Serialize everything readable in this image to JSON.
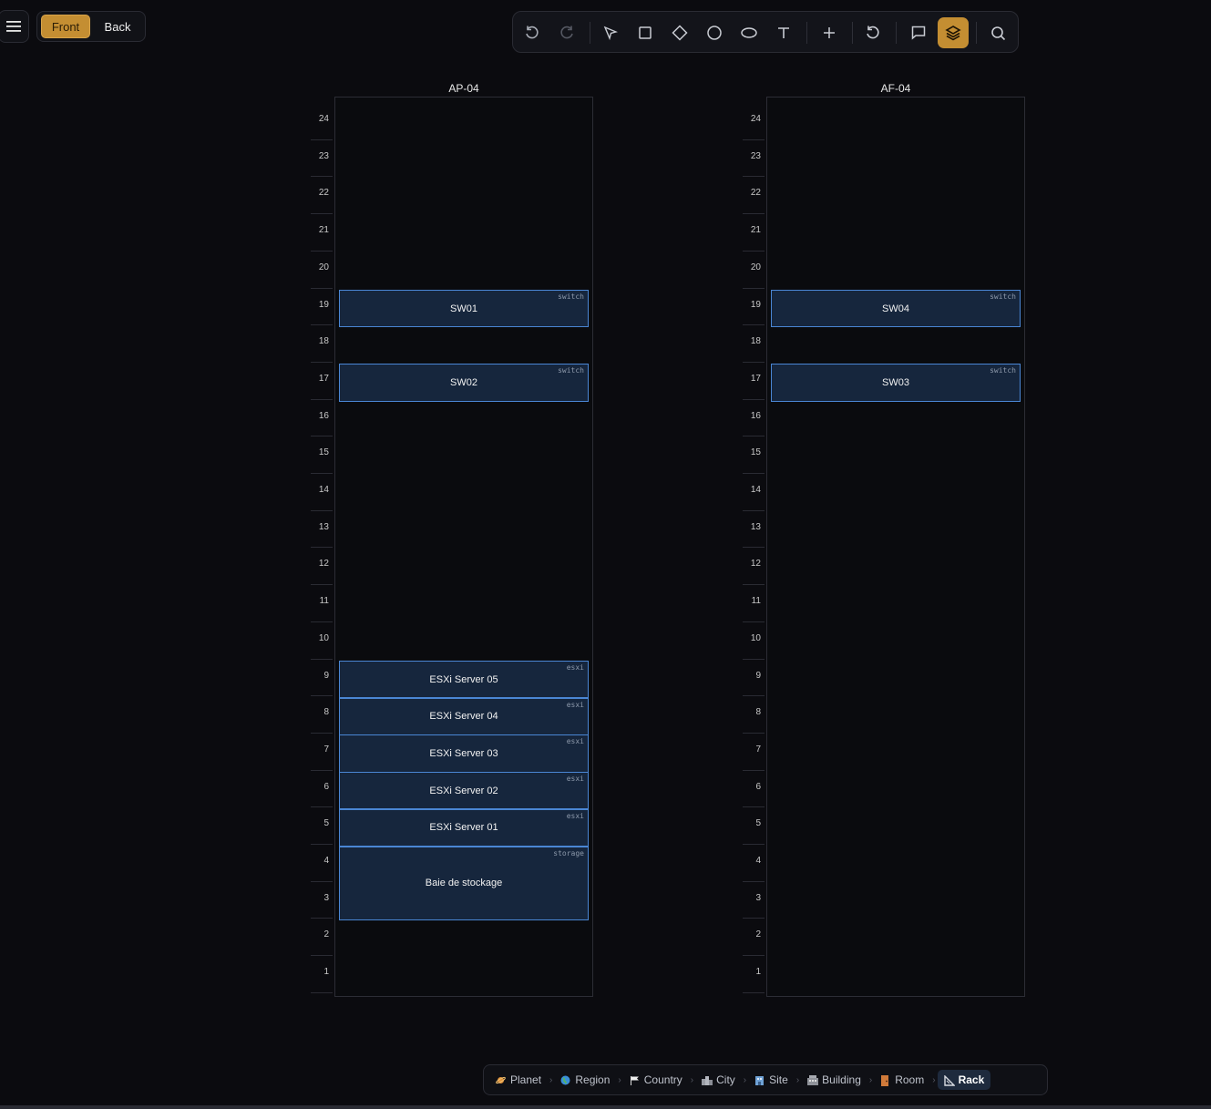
{
  "face_toggle": {
    "front_label": "Front",
    "back_label": "Back",
    "selected": "Front"
  },
  "toolbar": {
    "tools": [
      "undo-icon",
      "redo-icon",
      "select-icon",
      "rectangle-icon",
      "diamond-icon",
      "circle-icon",
      "ellipse-icon",
      "text-icon",
      "add-icon",
      "reset-icon",
      "comment-icon",
      "layers-icon",
      "search-icon"
    ],
    "active_tool": "layers-icon"
  },
  "racks": [
    {
      "name": "AP-04",
      "units": [
        "24",
        "23",
        "22",
        "21",
        "20",
        "19",
        "18",
        "17",
        "16",
        "15",
        "14",
        "13",
        "12",
        "11",
        "10",
        "9",
        "8",
        "7",
        "6",
        "5",
        "4",
        "3",
        "2",
        "1"
      ],
      "devices": [
        {
          "label": "SW01",
          "type": "switch",
          "top_u": 19,
          "height_u": 1
        },
        {
          "label": "SW02",
          "type": "switch",
          "top_u": 17,
          "height_u": 1
        },
        {
          "label": "ESXi Server 05",
          "type": "esxi",
          "top_u": 9,
          "height_u": 1
        },
        {
          "label": "ESXi Server 04",
          "type": "esxi",
          "top_u": 8,
          "height_u": 1
        },
        {
          "label": "ESXi Server 03",
          "type": "esxi",
          "top_u": 7,
          "height_u": 1
        },
        {
          "label": "ESXi Server 02",
          "type": "esxi",
          "top_u": 6,
          "height_u": 1
        },
        {
          "label": "ESXi Server 01",
          "type": "esxi",
          "top_u": 5,
          "height_u": 1
        },
        {
          "label": "Baie de stockage",
          "type": "storage",
          "top_u": 4,
          "height_u": 2
        }
      ]
    },
    {
      "name": "AF-04",
      "units": [
        "24",
        "23",
        "22",
        "21",
        "20",
        "19",
        "18",
        "17",
        "16",
        "15",
        "14",
        "13",
        "12",
        "11",
        "10",
        "9",
        "8",
        "7",
        "6",
        "5",
        "4",
        "3",
        "2",
        "1"
      ],
      "devices": [
        {
          "label": "SW04",
          "type": "switch",
          "top_u": 19,
          "height_u": 1
        },
        {
          "label": "SW03",
          "type": "switch",
          "top_u": 17,
          "height_u": 1
        }
      ]
    }
  ],
  "breadcrumb": {
    "items": [
      {
        "label": "Planet",
        "icon": "planet-icon"
      },
      {
        "label": "Region",
        "icon": "globe-icon"
      },
      {
        "label": "Country",
        "icon": "flag-icon"
      },
      {
        "label": "City",
        "icon": "city-icon"
      },
      {
        "label": "Site",
        "icon": "site-icon"
      },
      {
        "label": "Building",
        "icon": "building-icon"
      },
      {
        "label": "Room",
        "icon": "door-icon"
      },
      {
        "label": "Rack",
        "icon": "ruler-icon"
      }
    ],
    "active": "Rack"
  },
  "colors": {
    "accent": "#c48e32",
    "device_border": "#4a86d4",
    "device_fill": "#16263d",
    "background": "#0b0b0f"
  }
}
